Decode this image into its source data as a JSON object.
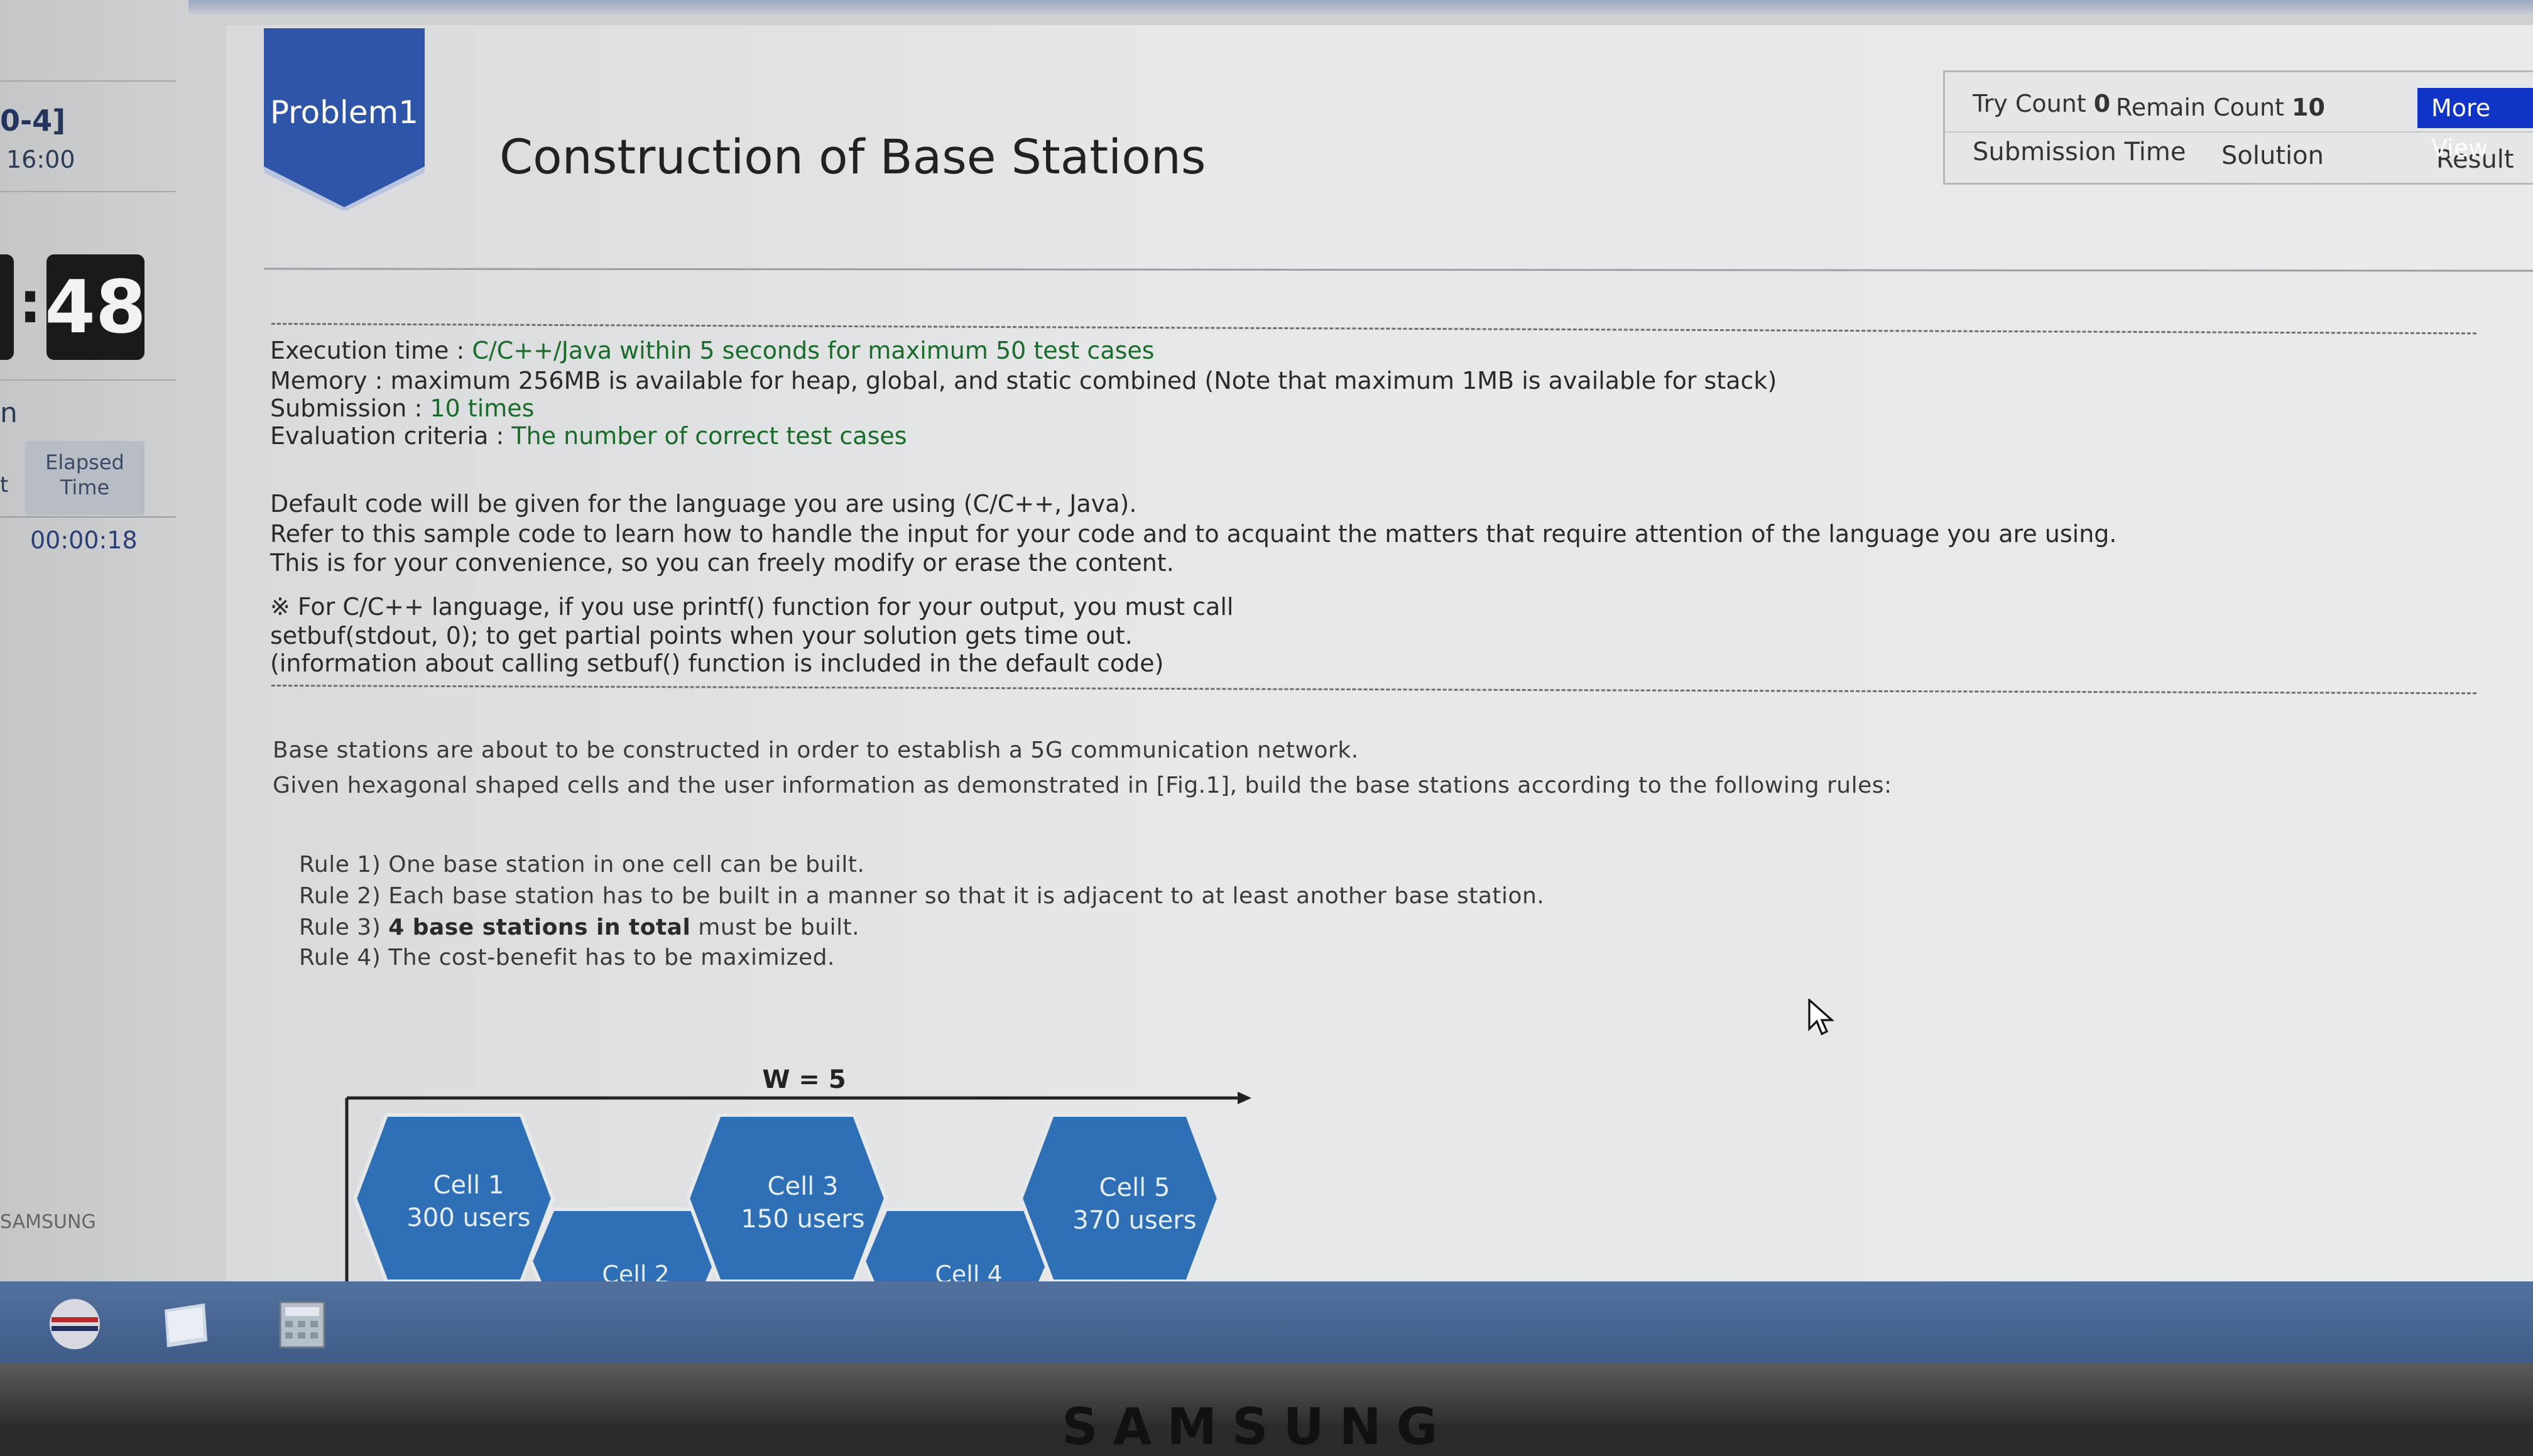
{
  "sidebar": {
    "range_label": "0-4]",
    "start_time": "16:00",
    "timer_value": "48",
    "timer_colon": ":",
    "side_letter": "n",
    "side_letter2": "t",
    "elapsed_label": "Elapsed Time",
    "elapsed_value": "00:00:18",
    "brand": "SAMSUNG"
  },
  "problem": {
    "badge_label": "Problem1",
    "title": "Construction of Base Stations",
    "badge_color": "#2f55a8"
  },
  "submission": {
    "try_label": "Try Count",
    "try_value": "0",
    "remain_label": "Remain Count",
    "remain_value": "10",
    "more_view_label": "More View",
    "col_time": "Submission Time",
    "col_solution": "Solution",
    "col_result": "Result"
  },
  "info": {
    "exec_label": "Execution time : ",
    "exec_value": "C/C++/Java within 5 seconds for maximum 50 test cases",
    "memory_text": "Memory : maximum 256MB is available for heap, global, and static combined (Note that maximum 1MB is available for stack)",
    "submission_label": "Submission : ",
    "submission_value": "10 times",
    "eval_label": "Evaluation criteria : ",
    "eval_value": "The number of correct test cases",
    "default1": "Default code will be given for the language you are using (C/C++, Java).",
    "default2": "Refer to this sample code to learn how to handle the input for your code and to acquaint the matters that require attention of the language you are using.",
    "default3": "This is for your convenience, so you can freely modify or erase the content.",
    "note1": "※ For C/C++ language, if you use printf() function for your output, you must call",
    "note2": "setbuf(stdout, 0); to get partial points when your solution gets time out.",
    "note3": "(information about calling setbuf() function is included in the default code)"
  },
  "description": {
    "line1": "Base stations are about to be constructed in order to establish a 5G communication network.",
    "line2": "Given hexagonal shaped cells and the user information as demonstrated in [Fig.1], build the base stations according to the following rules:",
    "rule1": "Rule 1) One base station in one cell can be built.",
    "rule2": "Rule 2) Each base station has to be built in a manner so that it is adjacent to at least another base station.",
    "rule3_prefix": "Rule 3) ",
    "rule3_bold": "4 base stations in total",
    "rule3_suffix": " must be built.",
    "rule4": "Rule 4) The cost-benefit has to be maximized."
  },
  "figure": {
    "width_label": "W = 5",
    "hex_color": "#2f6fb5",
    "cells": [
      {
        "name": "Cell 1",
        "users": "300 users"
      },
      {
        "name": "Cell 3",
        "users": "150 users"
      },
      {
        "name": "Cell 5",
        "users": "370 users"
      },
      {
        "name": "Cell 2"
      },
      {
        "name": "Cell 4"
      }
    ]
  },
  "monitor_brand": "SAMSUNG"
}
